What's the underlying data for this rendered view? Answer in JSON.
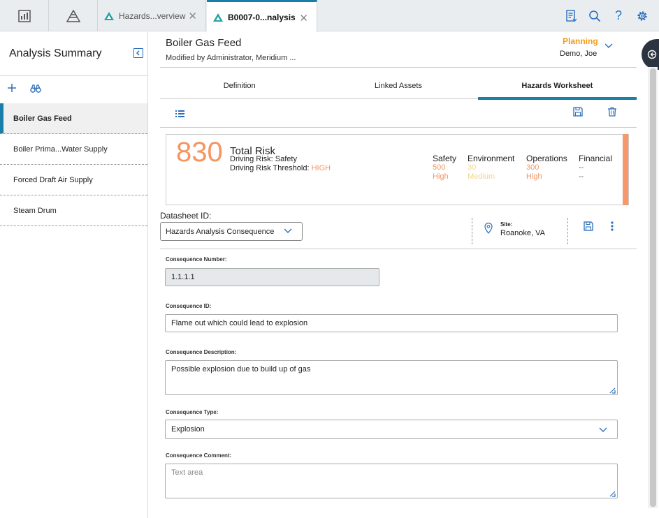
{
  "topbar": {
    "tabs": [
      {
        "label": "Hazards...verview",
        "active": false
      },
      {
        "label": "B0007-0...nalysis",
        "active": true
      }
    ]
  },
  "sidebar": {
    "title": "Analysis Summary",
    "items": [
      {
        "label": "Boiler Gas Feed",
        "selected": true
      },
      {
        "label": "Boiler Prima...Water Supply",
        "selected": false
      },
      {
        "label": "Forced Draft Air Supply",
        "selected": false
      },
      {
        "label": "Steam Drum",
        "selected": false
      }
    ]
  },
  "record": {
    "title": "Boiler Gas Feed",
    "subtitle": "Modified by Administrator, Meridium ...",
    "state": "Planning",
    "owner": "Demo, Joe"
  },
  "tabs": [
    {
      "label": "Definition",
      "active": false
    },
    {
      "label": "Linked Assets",
      "active": false
    },
    {
      "label": "Hazards Worksheet",
      "active": true
    }
  ],
  "risk": {
    "value": "830",
    "label": "Total Risk",
    "driving": "Driving Risk: Safety",
    "threshold_label": "Driving Risk Threshold: ",
    "threshold_value": "HIGH",
    "categories": [
      {
        "name": "Safety",
        "value": "500",
        "level": "High",
        "color": "#f79460"
      },
      {
        "name": "Environment",
        "value": "30",
        "level": "Medium",
        "color": "#f0d58a"
      },
      {
        "name": "Operations",
        "value": "300",
        "level": "High",
        "color": "#f79460"
      },
      {
        "name": "Financial",
        "value": "--",
        "level": "--",
        "color": "#666666"
      }
    ]
  },
  "datasheet": {
    "label": "Datasheet ID:",
    "value": "Hazards Analysis Consequence",
    "site_label": "Site:",
    "site_value": "Roanoke, VA"
  },
  "fields": {
    "number_label": "Consequence Number:",
    "number_value": "1.1.1.1",
    "id_label": "Consequence ID:",
    "id_value": "Flame out which could lead to explosion",
    "desc_label": "Consequence Description:",
    "desc_value": "Possible explosion due to build up of gas",
    "type_label": "Consequence Type:",
    "type_value": "Explosion",
    "comment_label": "Consequence Comment:",
    "comment_placeholder": "Text area"
  },
  "colors": {
    "accent": "#1a7fa8",
    "risk": "#f79460",
    "planning": "#f39c12",
    "icon_blue": "#2a6ebb"
  }
}
